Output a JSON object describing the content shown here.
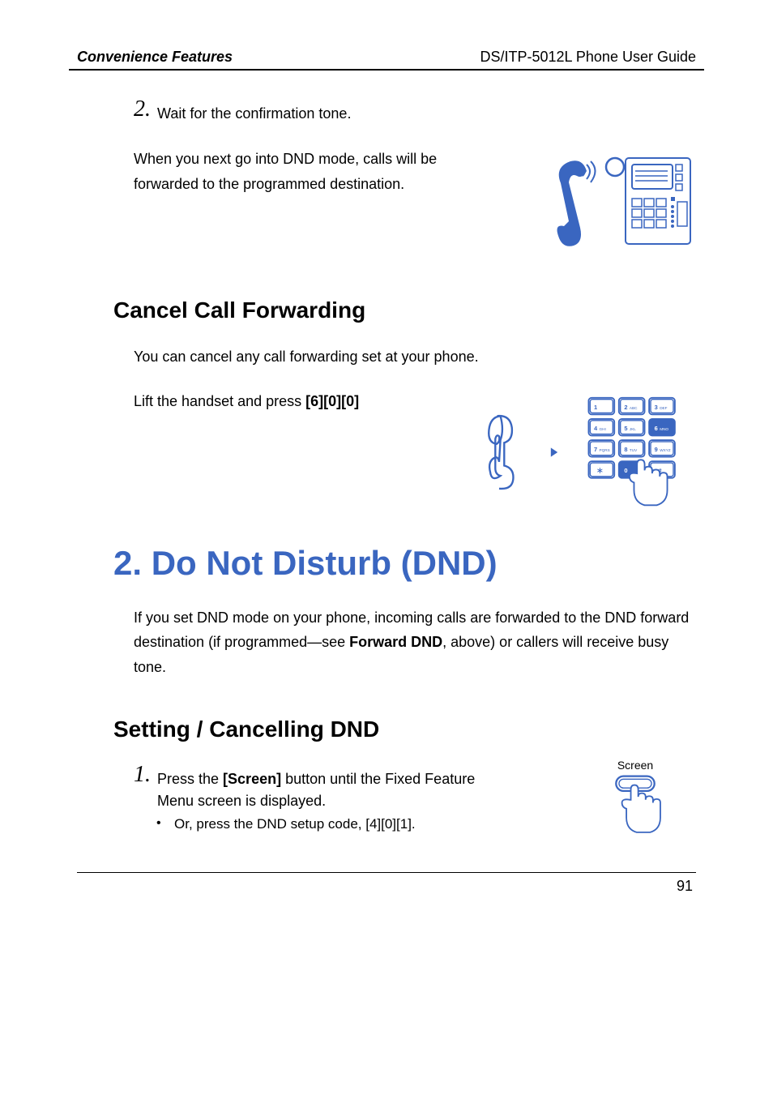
{
  "header": {
    "left": "Convenience Features",
    "right": "DS/ITP-5012L Phone User Guide"
  },
  "step2": {
    "num": "2.",
    "text": "Wait for the confirmation tone.",
    "after": "When you next go into DND mode, calls will be forwarded to the programmed destination."
  },
  "cancel": {
    "heading": "Cancel Call Forwarding",
    "intro": "You can cancel any call forwarding set at your phone.",
    "action_pre": "Lift the handset and press ",
    "action_bold": "[6][0][0]"
  },
  "dnd": {
    "heading": "2. Do Not Disturb (DND)",
    "intro_pre": "If you set DND mode on your phone, incoming calls are forwarded to the DND forward destination (if programmed—see ",
    "intro_bold": "Forward DND",
    "intro_post": ", above) or callers will receive busy tone."
  },
  "set": {
    "heading": "Setting / Cancelling DND",
    "step1_num": "1.",
    "step1_pre": "Press the ",
    "step1_bold": "[Screen]",
    "step1_post": " button until the Fixed Feature Menu screen is displayed.",
    "bullet": "Or, press the DND setup code, [4][0][1].",
    "screen_label": "Screen"
  },
  "page_number": "91",
  "icons": {
    "phone_console": "phone-console-icon",
    "handset": "handset-icon",
    "keypad": "keypad-icon",
    "arrow": "arrow-right-icon",
    "screen_button": "screen-button-icon",
    "hand_pointer": "hand-pointer-icon"
  }
}
